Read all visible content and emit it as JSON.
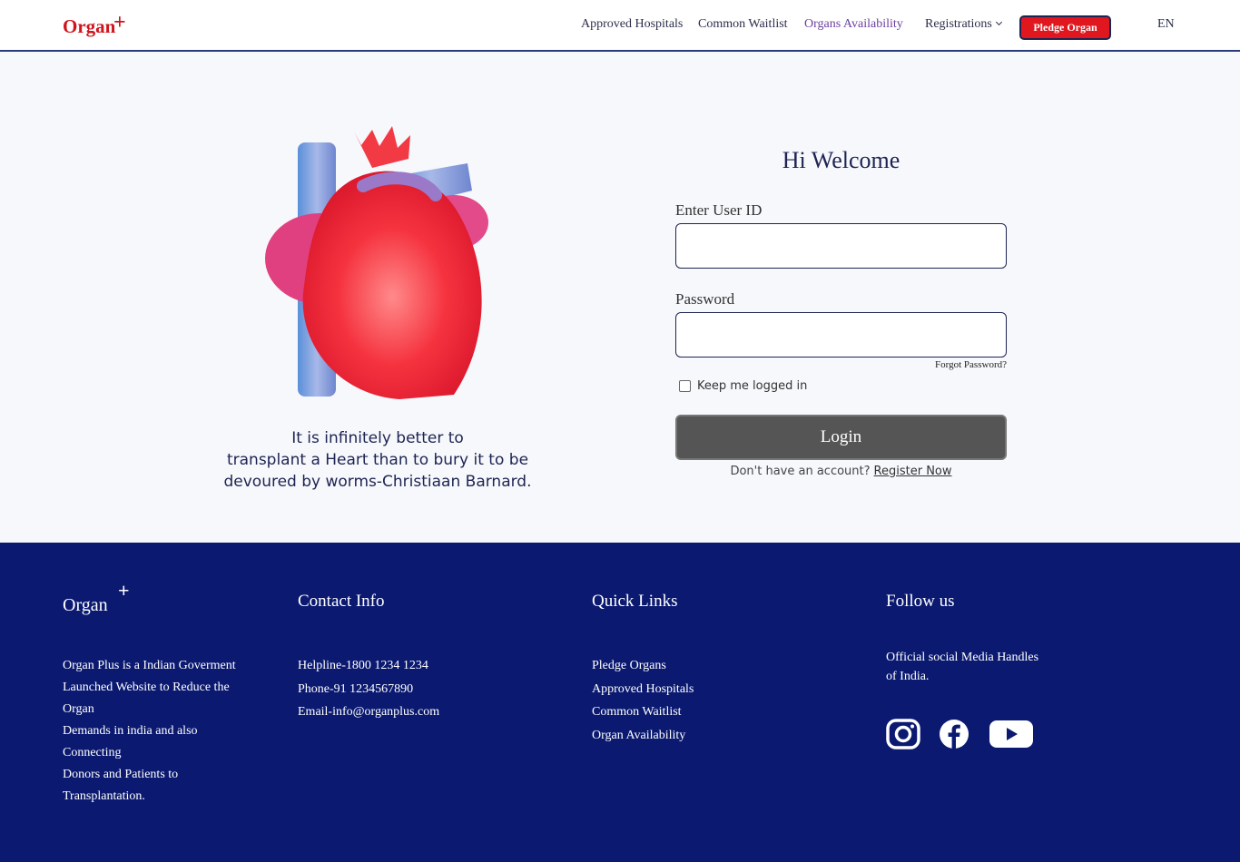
{
  "header": {
    "logo": "Organ",
    "logo_plus": "+",
    "nav": {
      "approved_hospitals": "Approved Hospitals",
      "common_waitlist": "Common Waitlist",
      "organs_availability": "Organs Availability",
      "registrations": "Registrations"
    },
    "pledge_button": "Pledge Organ",
    "language": "EN"
  },
  "hero": {
    "image_icon": "heart-illustration-icon",
    "quote_line1": "It is infinitely better to",
    "quote_line2": "transplant a Heart than to bury it to be",
    "quote_line3": "devoured by worms-Christiaan Barnard."
  },
  "login": {
    "title": "Hi Welcome",
    "user_label": "Enter User ID",
    "user_value": "",
    "password_label": "Password",
    "password_value": "",
    "forgot": "Forgot Password?",
    "keep_logged": "Keep me logged in",
    "button": "Login",
    "no_account": "Don't have an account?",
    "register": "Register Now"
  },
  "footer": {
    "logo": "Organ",
    "logo_plus": "+",
    "description": [
      "Organ Plus is a Indian Goverment",
      "Launched Website to Reduce the",
      "Organ",
      "Demands in india and also",
      "Connecting",
      "Donors and Patients to",
      "Transplantation."
    ],
    "contact_title": "Contact Info",
    "contact": [
      "Helpline-1800 1234 1234",
      "Phone-91 1234567890",
      "Email-info@organplus.com"
    ],
    "quick_title": "Quick Links",
    "quick": [
      "Pledge Organs",
      "Approved Hospitals",
      "Common Waitlist",
      "Organ Availability"
    ],
    "follow_title": "Follow us",
    "follow_text_line1": "Official social Media Handles",
    "follow_text_line2": "of India.",
    "social_icons": [
      "instagram-icon",
      "facebook-icon",
      "youtube-icon"
    ]
  },
  "colors": {
    "brand_red": "#d0141c",
    "pledge_red": "#e0171f",
    "navy": "#0b1a70",
    "active_nav": "#6b3fa0",
    "login_button": "#555555"
  }
}
